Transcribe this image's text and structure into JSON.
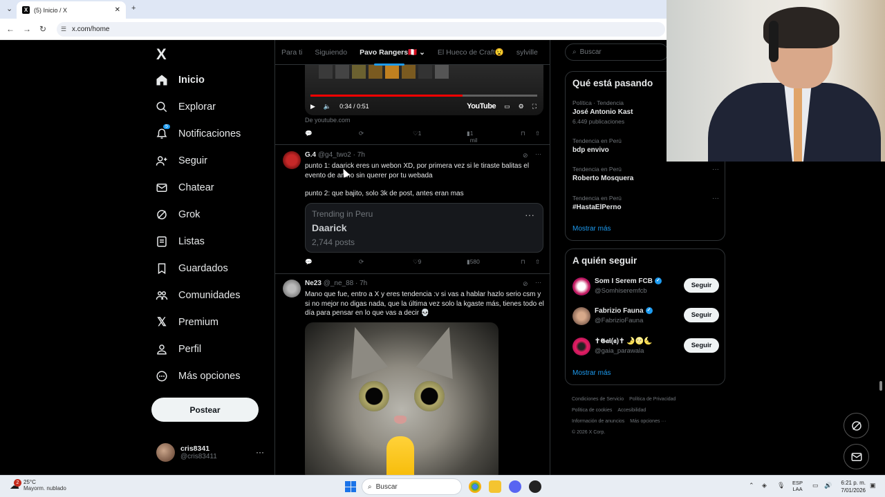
{
  "browser": {
    "tab_title": "(5) Inicio / X",
    "url": "x.com/home"
  },
  "sidebar": {
    "logo": "X",
    "items": [
      {
        "label": "Inicio",
        "icon": "home-icon",
        "active": true
      },
      {
        "label": "Explorar",
        "icon": "search-icon"
      },
      {
        "label": "Notificaciones",
        "icon": "bell-icon",
        "badge": "5"
      },
      {
        "label": "Seguir",
        "icon": "add-person-icon"
      },
      {
        "label": "Chatear",
        "icon": "mail-icon"
      },
      {
        "label": "Grok",
        "icon": "grok-icon"
      },
      {
        "label": "Listas",
        "icon": "list-icon"
      },
      {
        "label": "Guardados",
        "icon": "bookmark-icon"
      },
      {
        "label": "Comunidades",
        "icon": "communities-icon"
      },
      {
        "label": "Premium",
        "icon": "x-premium-icon"
      },
      {
        "label": "Perfil",
        "icon": "person-icon"
      },
      {
        "label": "Más opciones",
        "icon": "more-circle-icon"
      }
    ],
    "post_button": "Postear",
    "account": {
      "name": "cris8341",
      "handle": "@cris83411"
    }
  },
  "feed": {
    "tabs": [
      "Para ti",
      "Siguiendo",
      "Pavo Rangers🇵🇪",
      "El Hueco de Craft😧",
      "sylville"
    ],
    "active_tab": 2,
    "video": {
      "time": "0:34 / 0:51",
      "brand": "YouTube",
      "progress": 0.67,
      "source": "De youtube.com"
    },
    "video_actions": {
      "likes": "1",
      "views": "1 mil"
    },
    "posts": [
      {
        "name": "G.4",
        "handle": "@g4_two2",
        "time": "7h",
        "text1": "punto 1: daarick eres un webon XD, por primera vez si le tiraste balitas el evento de anino sin querer por tu webada",
        "text2": "punto 2: que bajito, solo 3k de post, antes eran mas",
        "card": {
          "label": "Trending in Peru",
          "topic": "Daarick",
          "count": "2,744 posts"
        },
        "likes": "9",
        "views": "580"
      },
      {
        "name": "Ne23",
        "handle": "@_ne_88",
        "time": "7h",
        "text": "Mano que fue, entro a X y eres tendencia :v si vas a hablar hazlo serio csm y si no mejor no digas nada, que la última vez solo la kgaste más, tienes todo el día para pensar en lo que vas a decir 💀"
      }
    ]
  },
  "right": {
    "search_placeholder": "Buscar",
    "trends_title": "Qué está pasando",
    "trends": [
      {
        "meta": "Política · Tendencia",
        "name": "José Antonio Kast",
        "count": "6.449 publicaciones"
      },
      {
        "meta": "Tendencia en Perú",
        "name": "bdp envivo",
        "count": ""
      },
      {
        "meta": "Tendencia en Perú",
        "name": "Roberto Mosquera",
        "count": ""
      },
      {
        "meta": "Tendencia en Perú",
        "name": "#HastaElPerno",
        "count": ""
      }
    ],
    "show_more": "Mostrar más",
    "who_title": "A quién seguir",
    "who": [
      {
        "name": "Som I Serem FCB",
        "handle": "@Somhiseremfcb",
        "verified": true
      },
      {
        "name": "Fabrizio Fauna",
        "handle": "@FabrizioFauna",
        "verified": true
      },
      {
        "name": "✝𝕲𝖆𝖎(𝖆)✝ 🌛🌝🌜",
        "handle": "@gaia_parawala",
        "verified": false
      }
    ],
    "follow_label": "Seguir",
    "footer": [
      "Condiciones de Servicio",
      "Política de Privacidad",
      "Política de cookies",
      "Accesibilidad",
      "Información de anuncios",
      "Más opciones ···",
      "© 2026 X Corp."
    ]
  },
  "taskbar": {
    "weather_temp": "25°C",
    "weather_desc": "Mayorm. nublado",
    "weather_badge": "2",
    "search_label": "Buscar",
    "lang": "ESP",
    "lang2": "LAA",
    "time": "6:21 p. m.",
    "date": "7/01/2026"
  }
}
